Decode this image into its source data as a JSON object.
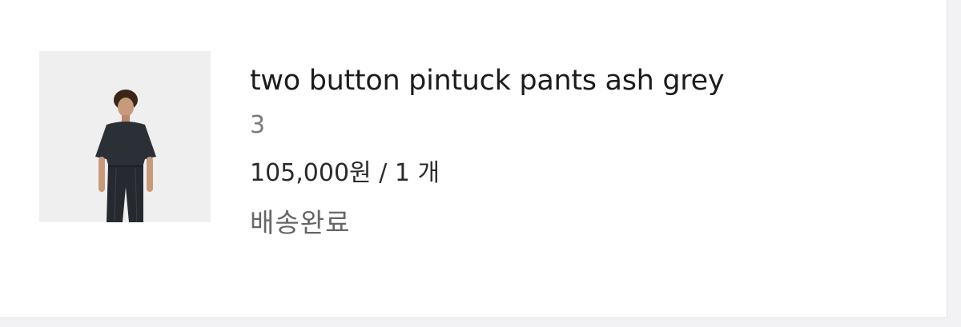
{
  "order_item": {
    "product_name": "two button pintuck pants ash grey",
    "option": "3",
    "price": "105,000원",
    "separator": " / ",
    "quantity": "1 개",
    "status": "배송완료"
  }
}
